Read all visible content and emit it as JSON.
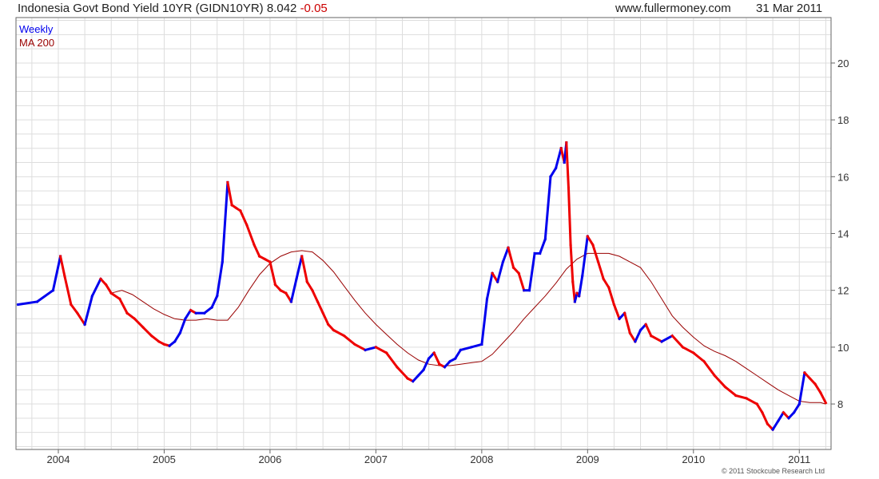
{
  "header": {
    "title": "Indonesia Govt Bond Yield 10YR (GIDN10YR)",
    "last": "8.042",
    "change": "-0.05",
    "source": "www.fullermoney.com",
    "date": "31 Mar 2011"
  },
  "footer": {
    "copyright": "© 2011 Stockcube Research Ltd"
  },
  "colors": {
    "up": "#0000ee",
    "down": "#ee0000",
    "ma": "#990000",
    "grid": "#dddddd",
    "frame": "#666666"
  },
  "chart_data": {
    "type": "line",
    "legend": [
      "Weekly",
      "MA 200"
    ],
    "legend_position": "top-left",
    "y_axis_side": "right",
    "x_ticks": [
      "2004",
      "2005",
      "2006",
      "2007",
      "2008",
      "2009",
      "2010",
      "2011"
    ],
    "y_ticks": [
      8,
      10,
      12,
      14,
      16,
      18,
      20
    ],
    "xlim": [
      2003.6,
      2011.3
    ],
    "ylim": [
      6.4,
      21.6
    ],
    "grid": true,
    "series": [
      {
        "name": "Weekly",
        "x": [
          2003.62,
          2003.8,
          2003.95,
          2004.02,
          2004.06,
          2004.12,
          2004.18,
          2004.25,
          2004.32,
          2004.4,
          2004.45,
          2004.5,
          2004.58,
          2004.65,
          2004.72,
          2004.8,
          2004.88,
          2004.95,
          2005.0,
          2005.05,
          2005.1,
          2005.15,
          2005.2,
          2005.25,
          2005.3,
          2005.38,
          2005.45,
          2005.5,
          2005.55,
          2005.6,
          2005.64,
          2005.68,
          2005.72,
          2005.78,
          2005.85,
          2005.9,
          2005.95,
          2006.0,
          2006.05,
          2006.1,
          2006.15,
          2006.2,
          2006.25,
          2006.3,
          2006.35,
          2006.4,
          2006.45,
          2006.5,
          2006.55,
          2006.6,
          2006.7,
          2006.8,
          2006.9,
          2007.0,
          2007.1,
          2007.2,
          2007.3,
          2007.35,
          2007.4,
          2007.45,
          2007.5,
          2007.55,
          2007.6,
          2007.65,
          2007.7,
          2007.75,
          2007.8,
          2007.9,
          2008.0,
          2008.05,
          2008.1,
          2008.15,
          2008.2,
          2008.25,
          2008.3,
          2008.35,
          2008.4,
          2008.45,
          2008.5,
          2008.55,
          2008.6,
          2008.65,
          2008.7,
          2008.75,
          2008.78,
          2008.8,
          2008.82,
          2008.84,
          2008.86,
          2008.88,
          2008.9,
          2008.92,
          2008.95,
          2009.0,
          2009.05,
          2009.1,
          2009.15,
          2009.2,
          2009.25,
          2009.3,
          2009.35,
          2009.4,
          2009.45,
          2009.5,
          2009.55,
          2009.6,
          2009.7,
          2009.8,
          2009.9,
          2010.0,
          2010.1,
          2010.2,
          2010.3,
          2010.4,
          2010.5,
          2010.6,
          2010.65,
          2010.7,
          2010.75,
          2010.8,
          2010.85,
          2010.9,
          2010.95,
          2011.0,
          2011.05,
          2011.1,
          2011.15,
          2011.2,
          2011.25
        ],
        "values": [
          11.5,
          11.6,
          12.0,
          13.2,
          12.5,
          11.5,
          11.2,
          10.8,
          11.8,
          12.4,
          12.2,
          11.9,
          11.7,
          11.2,
          11.0,
          10.7,
          10.4,
          10.2,
          10.1,
          10.05,
          10.2,
          10.5,
          11.0,
          11.3,
          11.2,
          11.2,
          11.4,
          11.8,
          13.0,
          15.8,
          15.0,
          14.9,
          14.8,
          14.3,
          13.6,
          13.2,
          13.1,
          13.0,
          12.2,
          12.0,
          11.9,
          11.6,
          12.4,
          13.2,
          12.3,
          12.0,
          11.6,
          11.2,
          10.8,
          10.6,
          10.4,
          10.1,
          9.9,
          10.0,
          9.8,
          9.3,
          8.9,
          8.8,
          9.0,
          9.2,
          9.6,
          9.8,
          9.4,
          9.3,
          9.5,
          9.6,
          9.9,
          10.0,
          10.1,
          11.7,
          12.6,
          12.3,
          13.0,
          13.5,
          12.8,
          12.6,
          12.0,
          12.0,
          13.3,
          13.3,
          13.8,
          16.0,
          16.3,
          17.0,
          16.5,
          17.2,
          15.6,
          13.6,
          12.3,
          11.6,
          11.9,
          11.8,
          12.5,
          13.9,
          13.6,
          13.0,
          12.4,
          12.1,
          11.5,
          11.0,
          11.2,
          10.5,
          10.2,
          10.6,
          10.8,
          10.4,
          10.2,
          10.4,
          10.0,
          9.8,
          9.5,
          9.0,
          8.6,
          8.3,
          8.2,
          8.0,
          7.7,
          7.3,
          7.1,
          7.4,
          7.7,
          7.5,
          7.7,
          8.0,
          9.1,
          8.9,
          8.7,
          8.4,
          8.04
        ]
      },
      {
        "name": "MA 200",
        "x": [
          2004.5,
          2004.6,
          2004.7,
          2004.8,
          2004.9,
          2005.0,
          2005.1,
          2005.2,
          2005.3,
          2005.4,
          2005.5,
          2005.6,
          2005.7,
          2005.8,
          2005.9,
          2006.0,
          2006.1,
          2006.2,
          2006.3,
          2006.4,
          2006.5,
          2006.6,
          2006.7,
          2006.8,
          2006.9,
          2007.0,
          2007.1,
          2007.2,
          2007.3,
          2007.4,
          2007.5,
          2007.6,
          2007.7,
          2007.8,
          2007.9,
          2008.0,
          2008.1,
          2008.2,
          2008.3,
          2008.4,
          2008.5,
          2008.6,
          2008.7,
          2008.8,
          2008.9,
          2009.0,
          2009.1,
          2009.2,
          2009.3,
          2009.4,
          2009.5,
          2009.6,
          2009.7,
          2009.8,
          2009.9,
          2010.0,
          2010.1,
          2010.2,
          2010.3,
          2010.4,
          2010.5,
          2010.6,
          2010.7,
          2010.8,
          2010.9,
          2011.0,
          2011.1,
          2011.2,
          2011.25
        ],
        "values": [
          11.9,
          12.0,
          11.85,
          11.6,
          11.35,
          11.15,
          11.0,
          10.95,
          10.95,
          11.0,
          10.95,
          10.95,
          11.4,
          12.0,
          12.55,
          12.95,
          13.2,
          13.35,
          13.4,
          13.35,
          13.05,
          12.65,
          12.15,
          11.65,
          11.2,
          10.8,
          10.45,
          10.1,
          9.8,
          9.55,
          9.4,
          9.35,
          9.35,
          9.4,
          9.45,
          9.5,
          9.75,
          10.15,
          10.55,
          11.0,
          11.4,
          11.8,
          12.25,
          12.75,
          13.1,
          13.3,
          13.3,
          13.3,
          13.2,
          13.0,
          12.8,
          12.3,
          11.7,
          11.1,
          10.7,
          10.35,
          10.05,
          9.85,
          9.7,
          9.5,
          9.25,
          9.0,
          8.75,
          8.5,
          8.3,
          8.1,
          8.05,
          8.05,
          8.0
        ]
      }
    ]
  }
}
